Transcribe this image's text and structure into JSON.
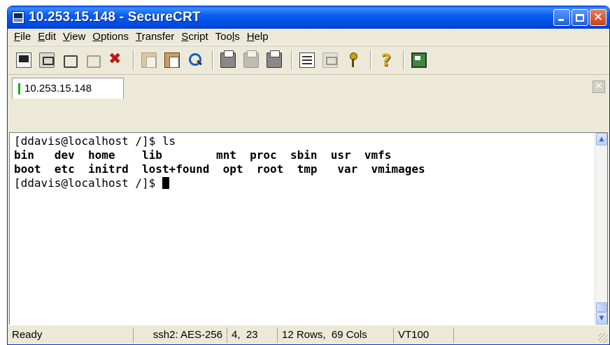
{
  "window": {
    "title": "10.253.15.148 - SecureCRT"
  },
  "menu": [
    "File",
    "Edit",
    "View",
    "Options",
    "Transfer",
    "Script",
    "Tools",
    "Help"
  ],
  "menu_mnemonics": [
    "F",
    "E",
    "V",
    "O",
    "T",
    "S",
    "l",
    "H"
  ],
  "toolbar": {
    "icons": [
      "connect-icon",
      "quick-connect-icon",
      "connect-tab-icon",
      "reconnect-icon",
      "disconnect-icon",
      "copy-icon",
      "paste-icon",
      "find-icon",
      "print-setup-icon",
      "print-selection-icon",
      "print-icon",
      "session-options-icon",
      "global-options-icon",
      "keymap-icon",
      "help-icon",
      "sftp-icon"
    ]
  },
  "tab": {
    "label": "10.253.15.148",
    "status_color": "#18b018"
  },
  "terminal": {
    "lines": [
      "[ddavis@localhost /]$ ls",
      "bin   dev  home    lib        mnt  proc  sbin  usr  vmfs",
      "boot  etc  initrd  lost+found  opt  root  tmp   var  vmimages",
      "[ddavis@localhost /]$ "
    ]
  },
  "status": {
    "state": "Ready",
    "cipher": "ssh2: AES-256",
    "cursor_pos": "4,  23",
    "size": "12 Rows,  69 Cols",
    "emulation": "VT100"
  },
  "colors": {
    "titlebar": "#0a5ef0",
    "chrome": "#ece9d8",
    "close": "#c8401c"
  }
}
